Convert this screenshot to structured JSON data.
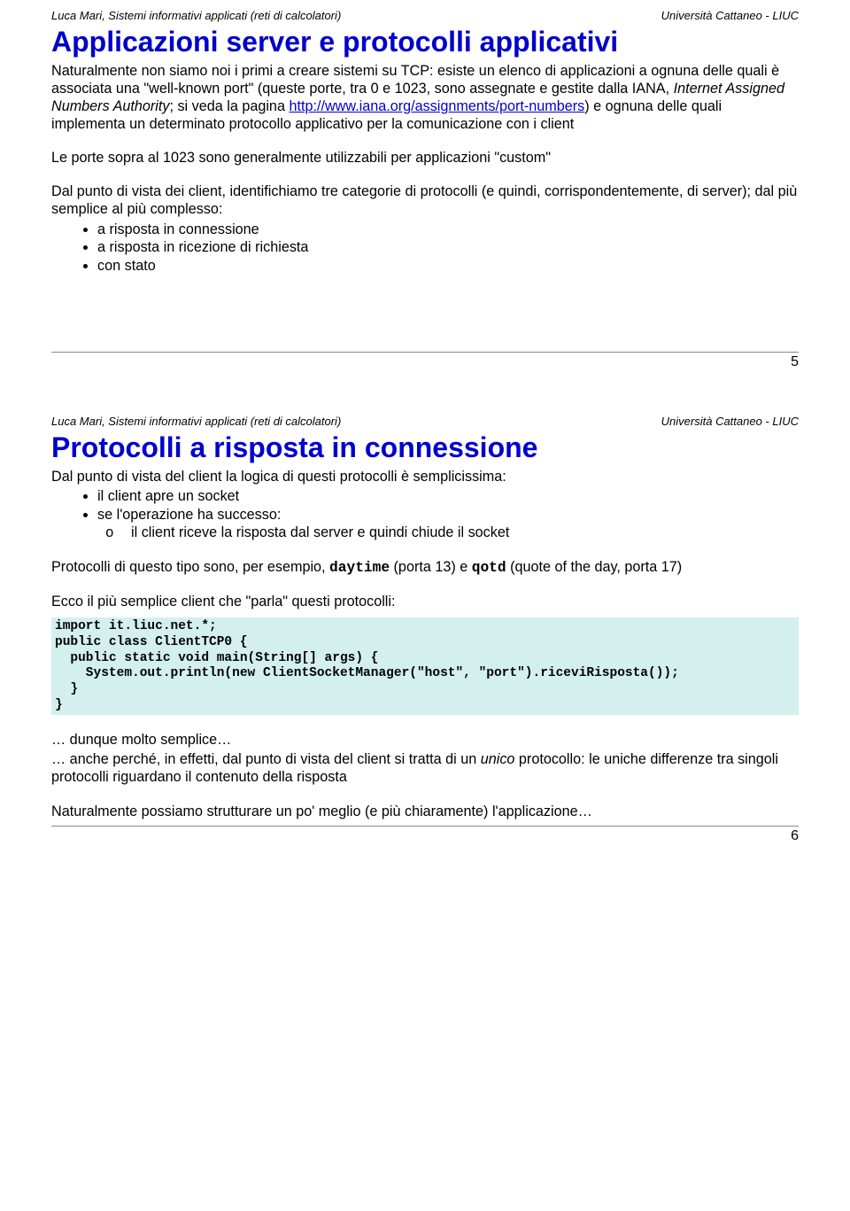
{
  "page1": {
    "header_left": "Luca Mari, Sistemi informativi applicati (reti di calcolatori)",
    "header_right": "Università Cattaneo - LIUC",
    "title": "Applicazioni server e protocolli applicativi",
    "p1_a": "Naturalmente non siamo noi i primi a creare sistemi su TCP: esiste un elenco di applicazioni a ognuna delle quali è associata una \"well-known port\" (queste porte, tra 0 e 1023, sono assegnate e gestite dalla IANA, ",
    "p1_italic": "Internet Assigned Numbers Authority",
    "p1_b": "; si veda la pagina ",
    "p1_link": "http://www.iana.org/assignments/port-numbers",
    "p1_c": ") e ognuna delle quali implementa un determinato protocollo applicativo per la comunicazione con i client",
    "p2": "Le porte sopra al 1023 sono generalmente utilizzabili per applicazioni \"custom\"",
    "p3": "Dal punto di vista dei client, identifichiamo tre categorie di protocolli (e quindi, corrispondentemente, di server); dal più semplice al più complesso:",
    "bullets": [
      "a risposta in connessione",
      "a risposta in ricezione di richiesta",
      "con stato"
    ],
    "page_number": "5"
  },
  "page2": {
    "header_left": "Luca Mari, Sistemi informativi applicati (reti di calcolatori)",
    "header_right": "Università Cattaneo - LIUC",
    "title": "Protocolli a risposta in connessione",
    "p1": "Dal punto di vista del client la logica di questi protocolli è semplicissima:",
    "bullets1": [
      "il client apre un socket",
      "se l'operazione ha successo:"
    ],
    "sub1": "il client riceve la risposta dal server e quindi chiude il socket",
    "p2_a": "Protocolli di questo tipo sono, per esempio, ",
    "p2_code1": "daytime",
    "p2_b": " (porta 13) e ",
    "p2_code2": "qotd",
    "p2_c": " (quote of the day, porta 17)",
    "p3": "Ecco il più semplice client che \"parla\" questi protocolli:",
    "code": "import it.liuc.net.*;\npublic class ClientTCP0 {\n  public static void main(String[] args) {\n    System.out.println(new ClientSocketManager(\"host\", \"port\").riceviRisposta());\n  }\n}",
    "p4": "… dunque molto semplice…",
    "p5_a": "… anche perché, in effetti, dal punto di vista del client si tratta di un ",
    "p5_italic": "unico",
    "p5_b": " protocollo: le uniche differenze tra singoli protocolli riguardano il contenuto della risposta",
    "p6": "Naturalmente possiamo strutturare un po' meglio (e più chiaramente) l'applicazione…",
    "page_number": "6"
  }
}
